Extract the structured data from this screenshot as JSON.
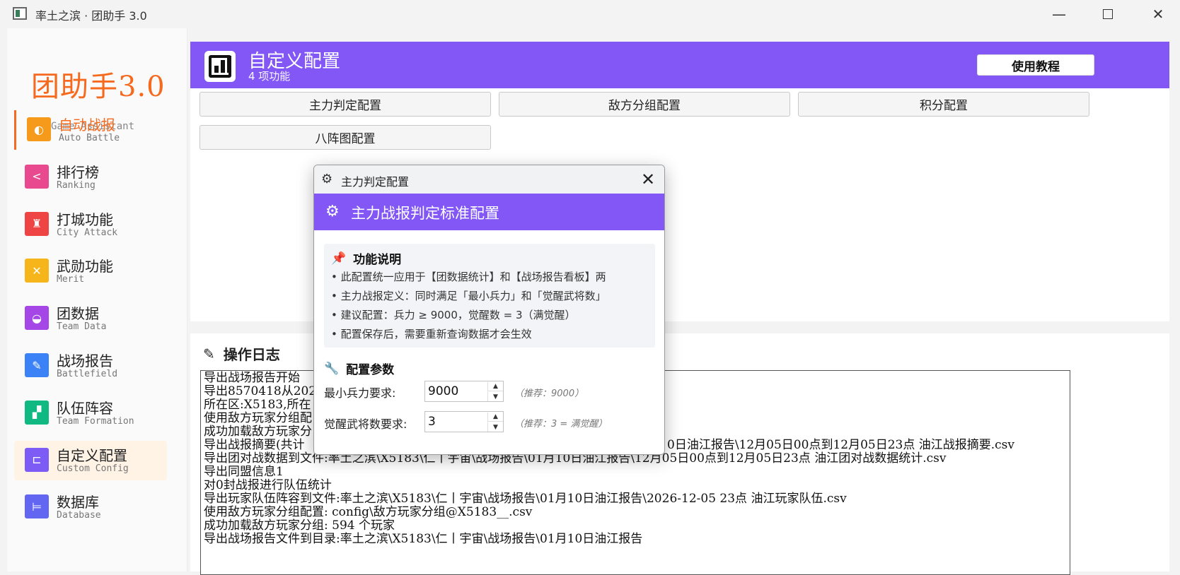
{
  "window": {
    "title": "率土之滨 · 团助手 3.0",
    "minimize": "—",
    "close": "✕"
  },
  "brand": {
    "title": "团助手3.0",
    "subtitle": "Game Assistant"
  },
  "sidebar": {
    "items": [
      {
        "label": "自动战报",
        "en": "Auto Battle",
        "icon": "battle-icon",
        "color": "#f59a1b",
        "glyph": "◐"
      },
      {
        "label": "排行榜",
        "en": "Ranking",
        "icon": "ranking-icon",
        "color": "#e94a8f",
        "glyph": "<"
      },
      {
        "label": "打城功能",
        "en": "City Attack",
        "icon": "castle-icon",
        "color": "#ef4444",
        "glyph": "♜"
      },
      {
        "label": "武勋功能",
        "en": "Merit",
        "icon": "crossed-swords-icon",
        "color": "#f5b51b",
        "glyph": "✕"
      },
      {
        "label": "团数据",
        "en": "Team Data",
        "icon": "team-data-icon",
        "color": "#a447e6",
        "glyph": "◒"
      },
      {
        "label": "战场报告",
        "en": "Battlefield",
        "icon": "report-icon",
        "color": "#3b82f6",
        "glyph": "✎"
      },
      {
        "label": "队伍阵容",
        "en": "Team Formation",
        "icon": "formation-icon",
        "color": "#10b981",
        "glyph": "▞"
      },
      {
        "label": "自定义配置",
        "en": "Custom Config",
        "icon": "config-icon",
        "color": "#7c5cf5",
        "glyph": "⊏"
      },
      {
        "label": "数据库",
        "en": "Database",
        "icon": "database-icon",
        "color": "#6366f1",
        "glyph": "⊨"
      }
    ]
  },
  "header": {
    "title": "自定义配置",
    "subtitle": "4 项功能",
    "tutorial_button": "使用教程",
    "accent": "#8257f5"
  },
  "config_buttons": [
    "主力判定配置",
    "敌方分组配置",
    "积分配置",
    "八阵图配置"
  ],
  "log": {
    "title": "操作日志",
    "lines": [
      "导出战场报告开始",
      "导出8570418从2026",
      "所在区:X5183,所在",
      "使用敌方玩家分组配",
      "成功加载敌方玩家分",
      "导出战报摘要(共计",
      "导出团对战数据到文件:率土之滨\\X5183\\仁丨宇宙\\战场报告\\01月10日油江报告\\12月05日00点到12月05日23点 油江团对战数据统计.csv",
      "导出同盟信息1",
      "对0封战报进行队伍统计",
      "导出玩家队伍阵容到文件:率土之滨\\X5183\\仁丨宇宙\\战场报告\\01月10日油江报告\\2026-12-05 23点 油江玩家队伍.csv",
      "使用敌方玩家分组配置: config\\敌方玩家分组@X5183__.csv",
      "成功加载敌方玩家分组: 594 个玩家",
      "导出战场报告文件到目录:率土之滨\\X5183\\仁丨宇宙\\战场报告\\01月10日油江报告"
    ],
    "line6_tail": "0日油江报告\\12月05日00点到12月05日23点 油江战报摘要.csv"
  },
  "dialog": {
    "title": "主力判定配置",
    "close": "✕",
    "band_title": "主力战报判定标准配置",
    "desc_title": "功能说明",
    "desc_lines": [
      "• 此配置统一应用于【团数据统计】和【战场报告看板】两",
      "• 主力战报定义：同时满足「最小兵力」和「觉醒武将数」",
      "• 建议配置：兵力 ≥ 9000，觉醒数 = 3（满觉醒）",
      "• 配置保存后，需要重新查询数据才会生效"
    ],
    "param_title": "配置参数",
    "params": [
      {
        "label": "最小兵力要求:",
        "value": "9000",
        "hint": "（推荐：9000）"
      },
      {
        "label": "觉醒武将数要求:",
        "value": "3",
        "hint": "（推荐：3 = 满觉醒）"
      }
    ]
  }
}
